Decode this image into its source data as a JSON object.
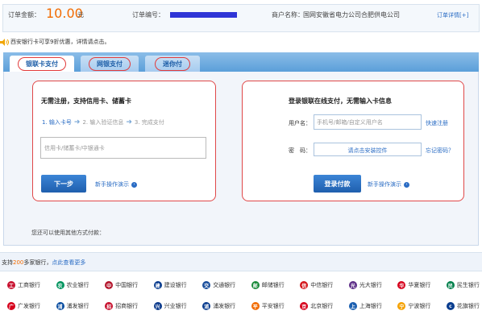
{
  "header": {
    "amount_label": "订单金额：",
    "amount_value": "10.00",
    "amount_unit": "元",
    "order_label": "订单编号：",
    "merchant_label": "商户名称：",
    "merchant_value": "国网安徽省电力公司合肥供电公司",
    "order_detail_link": "订单详情[+]"
  },
  "notice": {
    "text": "西安银行卡可享9折优惠，详情请点击。"
  },
  "tabs": [
    {
      "label": "银联卡支付",
      "active": true
    },
    {
      "label": "网银支付",
      "active": false
    },
    {
      "label": "迷你付",
      "active": false
    }
  ],
  "left_panel": {
    "title": "无需注册，支持信用卡、储蓄卡",
    "steps": [
      "1. 输入卡号",
      "2. 输入验证信息",
      "3. 完成支付"
    ],
    "card_placeholder": "信用卡/储蓄卡/中银通卡",
    "next_button": "下一步",
    "guide_link": "新手操作演示"
  },
  "right_panel": {
    "title": "登录银联在线支付，无需输入卡信息",
    "username_label": "用户名：",
    "username_placeholder": "手机号/邮箱/自定义用户名",
    "register_link": "快速注册",
    "password_label": "密　码：",
    "password_placeholder": "请点击安装控件",
    "forgot_link": "忘记密码？",
    "login_button": "登录付款",
    "guide_link": "新手操作演示"
  },
  "other_methods": "您还可以使用其他方式付款：",
  "support": {
    "prefix": "支持",
    "count": "200",
    "suffix": "多家银行，",
    "more_link": "点此查看更多"
  },
  "banks_row1": [
    {
      "name": "工商银行",
      "color": "#c8102e",
      "glyph": "工"
    },
    {
      "name": "农业银行",
      "color": "#00945e",
      "glyph": "农"
    },
    {
      "name": "中国银行",
      "color": "#b3142b",
      "glyph": "中"
    },
    {
      "name": "建设银行",
      "color": "#0a3d8f",
      "glyph": "建"
    },
    {
      "name": "交通银行",
      "color": "#1b4f9c",
      "glyph": "交"
    },
    {
      "name": "邮储银行",
      "color": "#1a8a3a",
      "glyph": "邮"
    },
    {
      "name": "中信银行",
      "color": "#d4161b",
      "glyph": "信"
    },
    {
      "name": "光大银行",
      "color": "#5b2c86",
      "glyph": "光"
    },
    {
      "name": "华夏银行",
      "color": "#d6001c",
      "glyph": "华"
    },
    {
      "name": "民生银行",
      "color": "#00804b",
      "glyph": "民"
    }
  ],
  "banks_row2": [
    {
      "name": "广发银行",
      "color": "#d6001c",
      "glyph": "广"
    },
    {
      "name": "浦发银行",
      "color": "#0a4ea1",
      "glyph": "浦"
    },
    {
      "name": "招商银行",
      "color": "#c8102e",
      "glyph": "招"
    },
    {
      "name": "兴业银行",
      "color": "#0b3a8c",
      "glyph": "兴"
    },
    {
      "name": "浦发银行",
      "color": "#0a3d8f",
      "glyph": "浦"
    },
    {
      "name": "平安银行",
      "color": "#f26b00",
      "glyph": "平"
    },
    {
      "name": "北京银行",
      "color": "#d6001c",
      "glyph": "京"
    },
    {
      "name": "上海银行",
      "color": "#1b5fb0",
      "glyph": "上"
    },
    {
      "name": "宁波银行",
      "color": "#f5a200",
      "glyph": "宁"
    },
    {
      "name": "花旗银行",
      "color": "#0a3d8f",
      "glyph": "c"
    }
  ]
}
